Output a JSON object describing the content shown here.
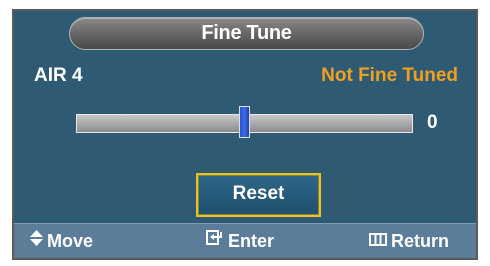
{
  "menu": {
    "title": "Fine Tune",
    "channel": "AIR 4",
    "status": "Not Fine Tuned",
    "status_color": "#f0a020"
  },
  "slider": {
    "value": "0",
    "position_fraction": 0.5
  },
  "reset_button": {
    "label": "Reset",
    "highlight_color": "#f0c020"
  },
  "footer": {
    "move": {
      "label": "Move",
      "icon": "up-down-arrows-icon"
    },
    "enter": {
      "label": "Enter",
      "icon": "enter-icon"
    },
    "return": {
      "label": "Return",
      "icon": "return-icon"
    }
  }
}
